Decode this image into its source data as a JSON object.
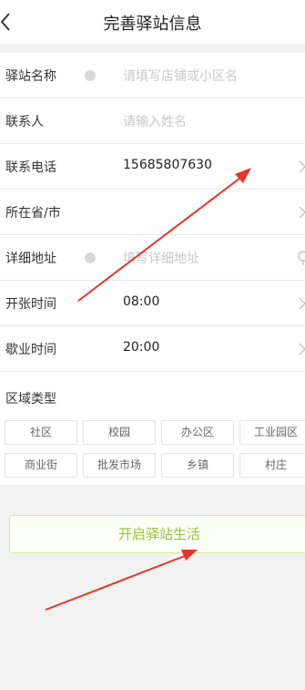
{
  "header": {
    "title": "完善驿站信息"
  },
  "form": {
    "station_name": {
      "label": "驿站名称",
      "placeholder": "请填写店铺或小区名"
    },
    "contact": {
      "label": "联系人",
      "placeholder": "请输入姓名"
    },
    "phone": {
      "label": "联系电话",
      "value": "15685807630"
    },
    "province": {
      "label": "所在省/市"
    },
    "address": {
      "label": "详细地址",
      "placeholder": "填写详细地址"
    },
    "open_time": {
      "label": "开张时间",
      "value": "08:00"
    },
    "close_time": {
      "label": "歇业时间",
      "value": "20:00"
    },
    "region_type": {
      "label": "区域类型",
      "options": [
        "社区",
        "校园",
        "办公区",
        "工业园区",
        "商业街",
        "批发市场",
        "乡镇",
        "村庄"
      ]
    }
  },
  "submit_label": "开启驿站生活",
  "colors": {
    "accent": "#9bc03d",
    "annotation_arrow": "#e8332a"
  }
}
